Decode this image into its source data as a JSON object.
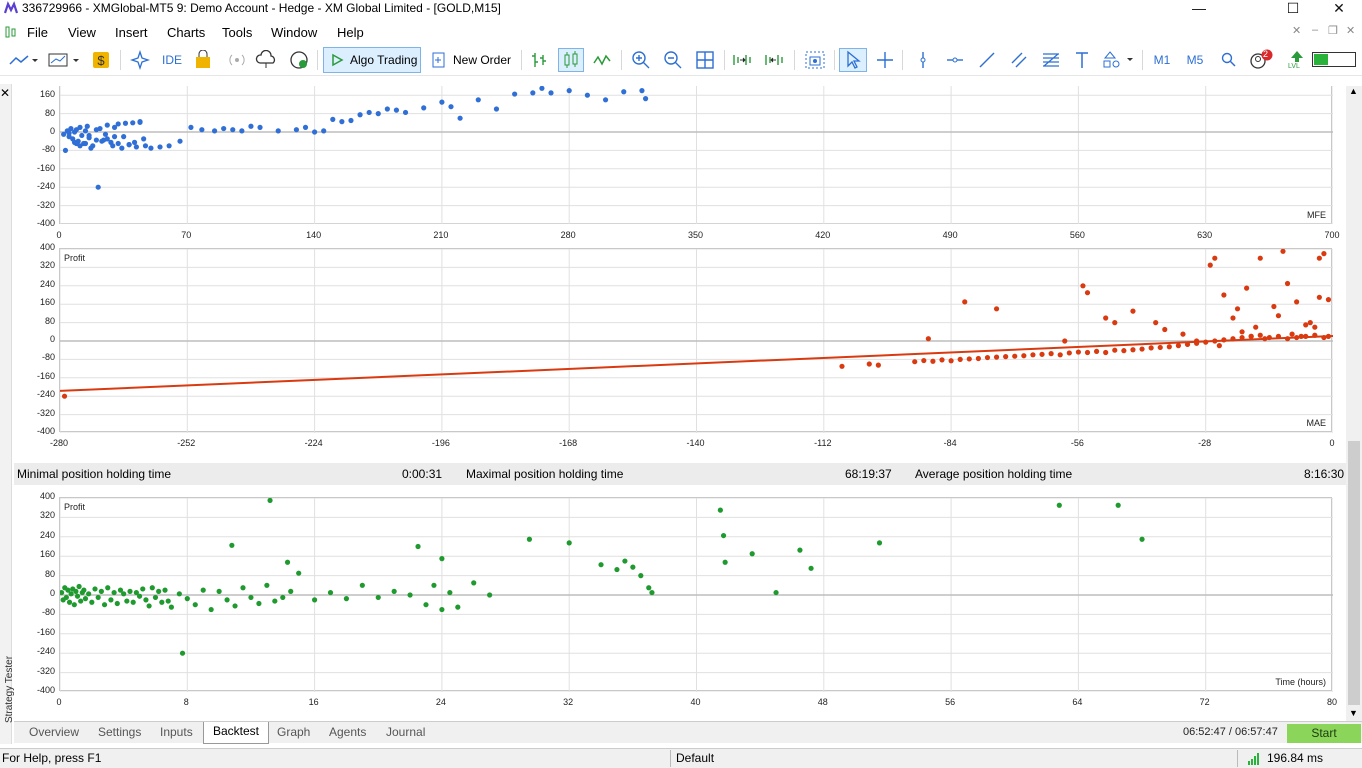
{
  "window": {
    "title": "336729966 - XMGlobal-MT5 9: Demo Account - Hedge - XM Global Limited - [GOLD,M15]",
    "minimize": "—",
    "maximize": "☐",
    "close": "✕"
  },
  "menu": [
    "File",
    "View",
    "Insert",
    "Charts",
    "Tools",
    "Window",
    "Help"
  ],
  "toolbar": {
    "ide_label": "IDE",
    "algo_label": "Algo Trading",
    "neworder_label": "New Order",
    "m1_label": "M1",
    "m5_label": "M5",
    "notif_count": "2",
    "lvl_label": "LVL"
  },
  "colors": {
    "mfe_points": "#2f6fd6",
    "mae_points": "#d93a10",
    "time_points": "#1e9a2e",
    "grid": "#e0e0e0",
    "start_button": "#8bd65a"
  },
  "mfe_chart": {
    "corner_label": "MFE",
    "y_ticks": [
      "160",
      "80",
      "0",
      "-80",
      "-160",
      "-240",
      "-320",
      "-400"
    ],
    "x_ticks": [
      "0",
      "70",
      "140",
      "210",
      "280",
      "350",
      "420",
      "490",
      "560",
      "630",
      "700"
    ],
    "chart_data": {
      "type": "scatter",
      "xlim": [
        0,
        700
      ],
      "ylim": [
        -400,
        200
      ],
      "x": [
        2,
        4,
        5,
        6,
        7,
        8,
        9,
        10,
        11,
        12,
        13,
        14,
        15,
        16,
        18,
        20,
        22,
        24,
        26,
        28,
        30,
        32,
        34,
        36,
        38,
        40,
        42,
        44,
        3,
        5,
        8,
        11,
        14,
        17,
        20,
        23,
        26,
        29,
        32,
        35,
        38,
        41,
        44,
        47,
        50,
        55,
        60,
        66,
        72,
        78,
        85,
        90,
        95,
        100,
        105,
        110,
        120,
        130,
        135,
        140,
        145,
        150,
        155,
        160,
        165,
        170,
        175,
        180,
        185,
        190,
        200,
        210,
        215,
        220,
        230,
        240,
        250,
        260,
        265,
        270,
        280,
        290,
        300,
        310,
        320,
        322,
        21,
        46,
        30,
        16,
        9,
        25
      ],
      "y": [
        -10,
        5,
        -20,
        15,
        -30,
        0,
        10,
        -40,
        20,
        -15,
        -50,
        5,
        25,
        -25,
        -60,
        10,
        15,
        -35,
        30,
        -45,
        20,
        35,
        -70,
        38,
        -55,
        40,
        -65,
        42,
        -80,
        -5,
        -45,
        -60,
        -50,
        -70,
        -35,
        -40,
        -30,
        -60,
        -50,
        -20,
        -55,
        -45,
        45,
        -60,
        -70,
        -65,
        -60,
        -40,
        20,
        10,
        5,
        15,
        10,
        5,
        25,
        20,
        5,
        10,
        20,
        0,
        5,
        55,
        45,
        50,
        75,
        85,
        80,
        100,
        95,
        85,
        105,
        130,
        110,
        60,
        140,
        100,
        165,
        170,
        190,
        170,
        180,
        160,
        140,
        175,
        180,
        145,
        -240,
        -30,
        -20,
        -15,
        -50,
        -10
      ]
    }
  },
  "mae_chart": {
    "corner_title": "Profit",
    "corner_label": "MAE",
    "y_ticks": [
      "400",
      "320",
      "240",
      "160",
      "80",
      "0",
      "-80",
      "-160",
      "-240",
      "-320",
      "-400"
    ],
    "x_ticks": [
      "-280",
      "-252",
      "-224",
      "-196",
      "-168",
      "-140",
      "-112",
      "-84",
      "-56",
      "-28",
      "0"
    ],
    "chart_data": {
      "type": "scatter",
      "xlim": [
        -280,
        0
      ],
      "ylim": [
        -400,
        400
      ],
      "trend_line": {
        "x": [
          -280,
          0
        ],
        "y": [
          -217,
          22
        ]
      },
      "x": [
        -279,
        -108,
        -102,
        -100,
        -92,
        -90,
        -88,
        -86,
        -84,
        -82,
        -80,
        -78,
        -76,
        -74,
        -72,
        -70,
        -68,
        -66,
        -64,
        -62,
        -60,
        -58,
        -56,
        -54,
        -52,
        -50,
        -48,
        -46,
        -44,
        -42,
        -40,
        -38,
        -36,
        -34,
        -32,
        -30,
        -28,
        -26,
        -24,
        -22,
        -20,
        -18,
        -16,
        -14,
        -12,
        -10,
        -8,
        -6,
        -4,
        -2,
        -1,
        -89,
        -81,
        -74,
        -59,
        -55,
        -54,
        -50,
        -48,
        -44,
        -39,
        -37,
        -33,
        -30,
        -25,
        -24,
        -22,
        -20,
        -18,
        -17,
        -15,
        -13,
        -12,
        -10,
        -9,
        -7,
        -5,
        -4,
        -3,
        -2,
        -1,
        -27,
        -26,
        -21,
        -19,
        -16,
        -11,
        -8,
        -6,
        -3
      ],
      "y": [
        -240,
        -110,
        -100,
        -105,
        -90,
        -85,
        -88,
        -82,
        -86,
        -80,
        -78,
        -76,
        -72,
        -70,
        -68,
        -66,
        -64,
        -60,
        -58,
        -55,
        -60,
        -52,
        -48,
        -50,
        -45,
        -50,
        -40,
        -42,
        -38,
        -35,
        -30,
        -28,
        -25,
        -20,
        -15,
        -10,
        -5,
        0,
        5,
        10,
        15,
        20,
        25,
        15,
        20,
        10,
        15,
        20,
        25,
        15,
        20,
        10,
        170,
        140,
        0,
        240,
        210,
        100,
        80,
        130,
        80,
        50,
        30,
        0,
        -20,
        200,
        100,
        40,
        20,
        60,
        10,
        150,
        110,
        250,
        30,
        20,
        80,
        60,
        360,
        380,
        180,
        330,
        360,
        140,
        230,
        360,
        390,
        170,
        70,
        190
      ]
    }
  },
  "stats": {
    "min_label": "Minimal position holding time",
    "min_value": "0:00:31",
    "max_label": "Maximal position holding time",
    "max_value": "68:19:37",
    "avg_label": "Average position holding time",
    "avg_value": "8:16:30"
  },
  "time_chart": {
    "corner_title": "Profit",
    "corner_label": "Time (hours)",
    "y_ticks": [
      "400",
      "320",
      "240",
      "160",
      "80",
      "0",
      "-80",
      "-160",
      "-240",
      "-320",
      "-400"
    ],
    "x_ticks": [
      "0",
      "8",
      "16",
      "24",
      "32",
      "40",
      "48",
      "56",
      "64",
      "72",
      "80"
    ],
    "chart_data": {
      "type": "scatter",
      "xlim": [
        0,
        80
      ],
      "ylim": [
        -400,
        400
      ],
      "x": [
        0.1,
        0.2,
        0.3,
        0.4,
        0.5,
        0.6,
        0.7,
        0.8,
        0.9,
        1.0,
        1.1,
        1.2,
        1.3,
        1.4,
        1.5,
        1.6,
        1.8,
        2.0,
        2.2,
        2.4,
        2.6,
        2.8,
        3.0,
        3.2,
        3.4,
        3.6,
        3.8,
        4.0,
        4.2,
        4.4,
        4.6,
        4.8,
        5.0,
        5.2,
        5.4,
        5.6,
        5.8,
        6.0,
        6.2,
        6.4,
        6.6,
        6.8,
        7.0,
        7.5,
        8.0,
        8.5,
        9.0,
        9.5,
        10.0,
        10.5,
        11.0,
        11.5,
        12.0,
        12.5,
        13.0,
        13.5,
        14.0,
        14.5,
        15.0,
        16.0,
        17.0,
        18.0,
        19.0,
        20.0,
        21.0,
        22.0,
        23.0,
        23.5,
        24.0,
        24.5,
        25.0,
        26.0,
        27.0,
        7.7,
        10.8,
        13.2,
        14.3,
        22.5,
        24.0,
        29.5,
        32.0,
        34.0,
        35.0,
        35.5,
        36.0,
        36.5,
        37.0,
        37.2,
        41.5,
        41.7,
        41.8,
        43.5,
        45.0,
        46.5,
        47.2,
        51.5,
        62.8,
        66.5,
        68.0
      ],
      "y": [
        10,
        -20,
        30,
        -10,
        20,
        -30,
        5,
        25,
        -40,
        15,
        -5,
        35,
        -25,
        10,
        20,
        -15,
        5,
        -30,
        25,
        -10,
        15,
        -40,
        30,
        -20,
        10,
        -35,
        20,
        5,
        -25,
        15,
        -30,
        10,
        -5,
        25,
        -20,
        -45,
        30,
        -10,
        15,
        -30,
        20,
        -25,
        -50,
        5,
        -15,
        -40,
        20,
        -60,
        15,
        -20,
        -45,
        30,
        -10,
        -35,
        40,
        -25,
        -10,
        15,
        90,
        -20,
        10,
        -15,
        40,
        -10,
        15,
        0,
        -40,
        40,
        -60,
        10,
        -50,
        50,
        0,
        -240,
        205,
        390,
        135,
        200,
        150,
        230,
        215,
        125,
        105,
        140,
        115,
        80,
        30,
        10,
        350,
        245,
        135,
        170,
        10,
        185,
        110,
        215,
        370,
        370,
        230
      ]
    }
  },
  "sidetab_label": "Strategy Tester",
  "tabs": [
    "Overview",
    "Settings",
    "Inputs",
    "Backtest",
    "Graph",
    "Agents",
    "Journal"
  ],
  "active_tab": "Backtest",
  "tester": {
    "time_info": "06:52:47 / 06:57:47",
    "start_label": "Start"
  },
  "statusbar": {
    "help": "For Help, press F1",
    "profile": "Default",
    "ping": "196.84 ms"
  }
}
